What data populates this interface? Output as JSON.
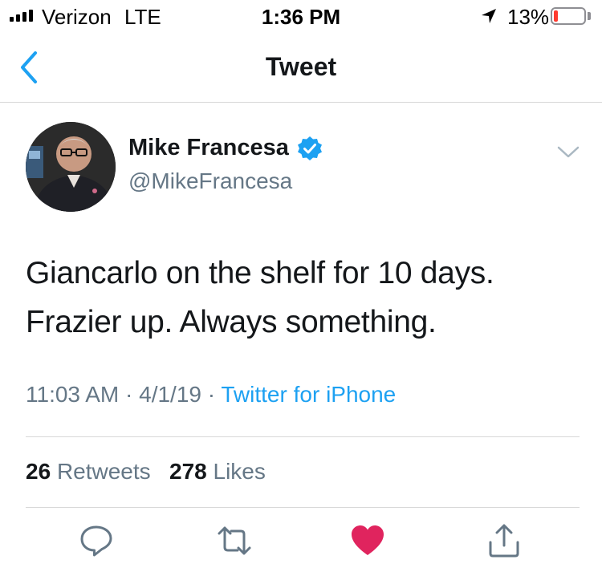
{
  "status_bar": {
    "carrier": "Verizon",
    "network": "LTE",
    "time": "1:36 PM",
    "battery_percent": "13%",
    "battery_level": 0.13,
    "icons": [
      "signal-bars-icon",
      "location-arrow-icon",
      "battery-icon"
    ]
  },
  "nav": {
    "title": "Tweet",
    "back_icon": "chevron-left-icon"
  },
  "tweet": {
    "author_name": "Mike Francesa",
    "author_handle": "@MikeFrancesa",
    "verified": true,
    "text_lines": [
      "Giancarlo on the shelf for 10 days.",
      "Frazier up. Always something."
    ],
    "time": "11:03 AM",
    "date": "4/1/19",
    "separator": "·",
    "source": "Twitter for iPhone",
    "retweets_count": "26",
    "retweets_label": "Retweets",
    "likes_count": "278",
    "likes_label": "Likes",
    "liked": true
  },
  "actions": [
    "reply-icon",
    "retweet-icon",
    "like-icon",
    "share-icon"
  ],
  "colors": {
    "accent": "#1da1f2",
    "like": "#e0245e",
    "secondary_text": "#657786",
    "primary_text": "#14171a",
    "battery_low": "#ff3b30"
  }
}
